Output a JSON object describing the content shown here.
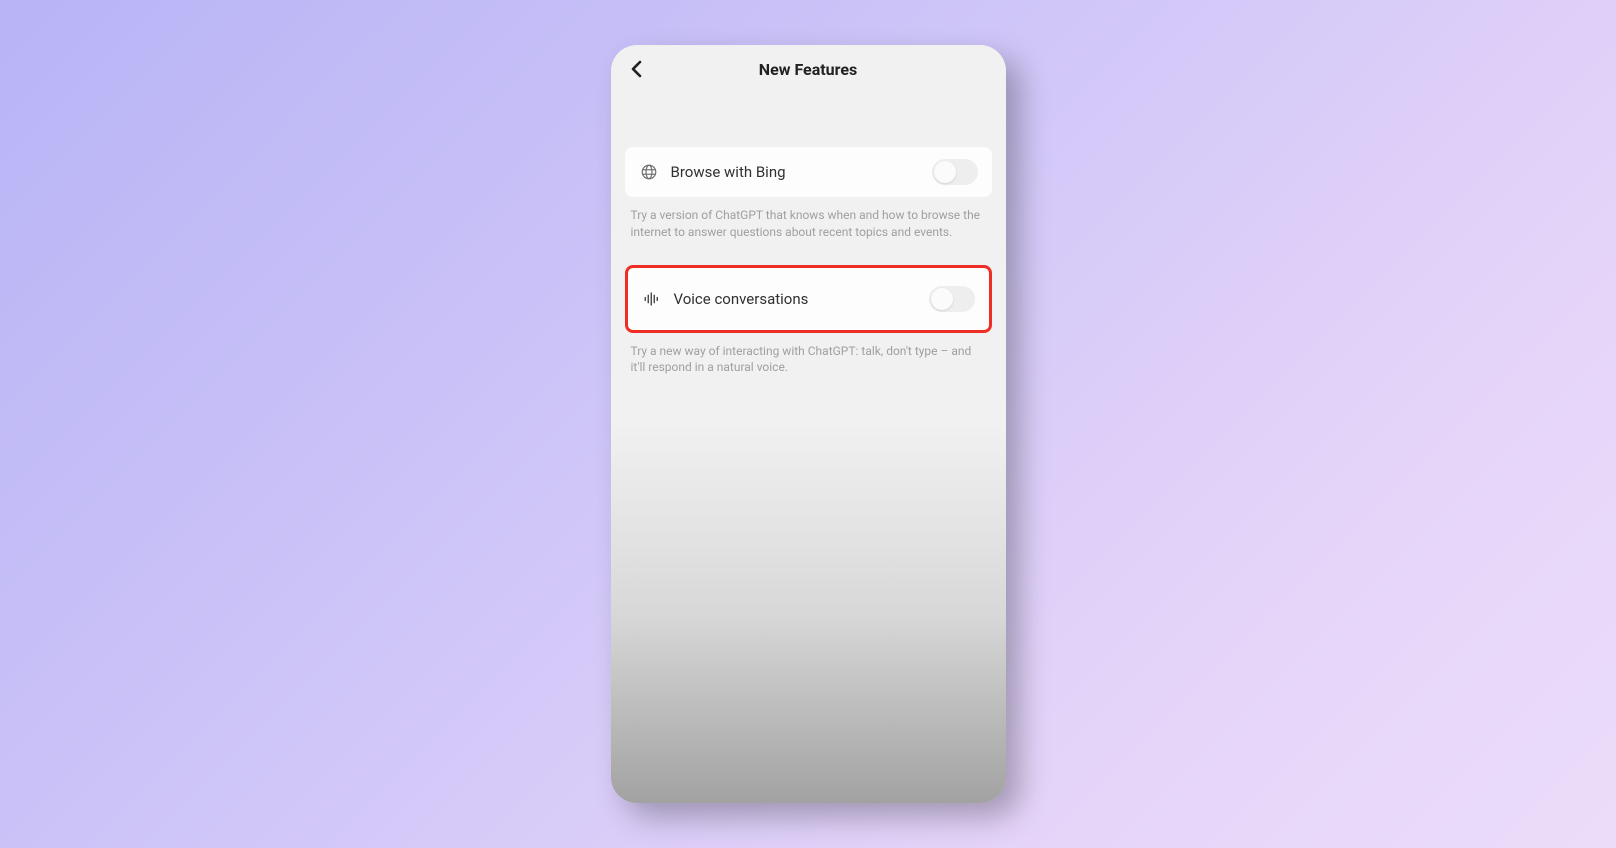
{
  "header": {
    "title": "New Features"
  },
  "settings": [
    {
      "label": "Browse with Bing",
      "description": "Try a version of ChatGPT that knows when and how to browse the internet to answer questions about recent topics and events.",
      "highlighted": false
    },
    {
      "label": "Voice conversations",
      "description": "Try a new way of interacting with ChatGPT: talk, don't type – and it'll respond in a natural voice.",
      "highlighted": true
    }
  ]
}
